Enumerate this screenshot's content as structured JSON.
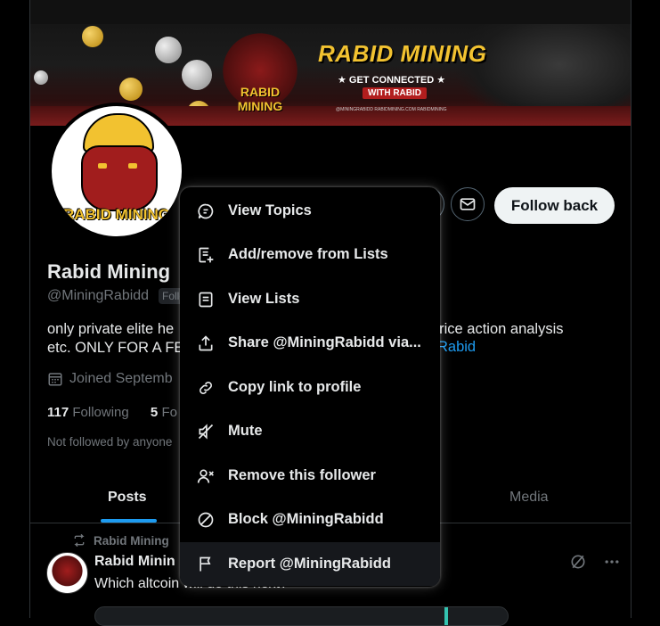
{
  "banner": {
    "logo_text": "RABID MINING",
    "headline": "RABID MINING",
    "tagline": "★ GET CONNECTED ★",
    "subtagline": "WITH RABID",
    "socials": "@MININGRABIDD   RABIDMINING.COM   RABIDMINING"
  },
  "avatar": {
    "label": "RABID MINING"
  },
  "actions": {
    "follow_label": "Follow back"
  },
  "profile": {
    "name": "Rabid Mining",
    "handle": "@MiningRabidd",
    "follows_badge": "Follo",
    "bio_line1": "only private elite he",
    "bio_line2": "etc. ONLY FOR A FE",
    "bio_right": "et, price action analysis",
    "bio_link": "Rabid",
    "joined": "Joined Septemb",
    "following_count": "117",
    "following_label": "Following",
    "followers_count": "5",
    "followers_label": "Fo",
    "not_followed": "Not followed by anyone"
  },
  "tabs": {
    "posts": "Posts",
    "media": "Media"
  },
  "post": {
    "repost_label": "Rabid Mining",
    "name": "Rabid Minin",
    "text": "Which altcoin will do this next?"
  },
  "menu": {
    "items": [
      {
        "label": "View Topics",
        "icon": "topics-icon"
      },
      {
        "label": "Add/remove from Lists",
        "icon": "list-add-icon"
      },
      {
        "label": "View Lists",
        "icon": "list-icon"
      },
      {
        "label": "Share @MiningRabidd via...",
        "icon": "share-icon"
      },
      {
        "label": "Copy link to profile",
        "icon": "link-icon"
      },
      {
        "label": "Mute",
        "icon": "mute-icon"
      },
      {
        "label": "Remove this follower",
        "icon": "remove-follower-icon"
      },
      {
        "label": "Block @MiningRabidd",
        "icon": "block-icon"
      },
      {
        "label": "Report @MiningRabidd",
        "icon": "flag-icon"
      }
    ]
  }
}
